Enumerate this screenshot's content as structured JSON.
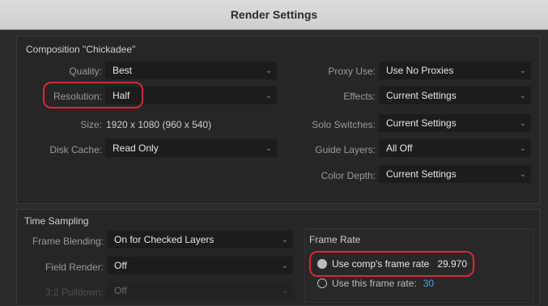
{
  "window": {
    "title": "Render Settings"
  },
  "composition": {
    "title": "Composition \"Chickadee\"",
    "quality": {
      "label": "Quality:",
      "value": "Best"
    },
    "resolution": {
      "label": "Resolution:",
      "value": "Half"
    },
    "size": {
      "label": "Size:",
      "value": "1920 x 1080 (960 x 540)"
    },
    "disk_cache": {
      "label": "Disk Cache:",
      "value": "Read Only"
    },
    "proxy_use": {
      "label": "Proxy Use:",
      "value": "Use No Proxies"
    },
    "effects": {
      "label": "Effects:",
      "value": "Current Settings"
    },
    "solo_switches": {
      "label": "Solo Switches:",
      "value": "Current Settings"
    },
    "guide_layers": {
      "label": "Guide Layers:",
      "value": "All Off"
    },
    "color_depth": {
      "label": "Color Depth:",
      "value": "Current Settings"
    }
  },
  "time_sampling": {
    "title": "Time Sampling",
    "frame_blending": {
      "label": "Frame Blending:",
      "value": "On for Checked Layers"
    },
    "field_render": {
      "label": "Field Render:",
      "value": "Off"
    },
    "pulldown": {
      "label": "3:2 Pulldown:",
      "value": "Off"
    },
    "frame_rate": {
      "title": "Frame Rate",
      "use_comp_label": "Use comp's frame rate",
      "comp_rate": "29.970",
      "use_this_label": "Use this frame rate:",
      "this_rate": "30",
      "selected": "use_comp"
    }
  },
  "colors": {
    "highlight": "#d32a3a",
    "accent": "#4aa3df"
  }
}
